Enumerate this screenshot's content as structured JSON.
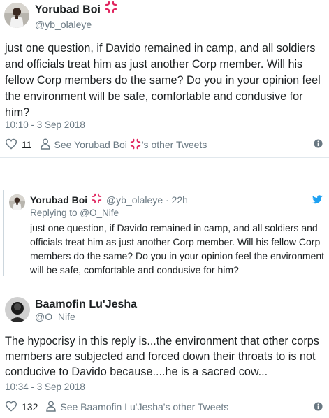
{
  "tweet1": {
    "name": "Yorubad Boi",
    "handle": "@yb_olaleye",
    "text": "just one question, if Davido remained in camp,  and all soldiers and officials treat him as just another Corp member.  Will his fellow Corp members do the same?  Do you in your opinion feel the environment will be safe, comfortable and condusive for him?",
    "timestamp": "10:10 - 3 Sep 2018",
    "likes": "11",
    "see_other_prefix": "See Yorubad Boi",
    "see_other_suffix": "'s other Tweets"
  },
  "tweet2": {
    "name": "Yorubad Boi",
    "handle": "@yb_olaleye",
    "separator": "·",
    "age": "22h",
    "replying_to": "Replying to @O_Nife",
    "text": "just one question, if Davido remained in camp,  and all soldiers and officials treat him as just another Corp member.  Will his fellow Corp members do the same?  Do you in your opinion feel the environment will be safe, comfortable and condusive for him?"
  },
  "tweet3": {
    "name": "Baamofin Lu'Jesha",
    "handle": "@O_Nife",
    "text": "The hypocrisy in this reply is...the environment that other corps members are subjected and forced down their throats to is not conducive to Davido because....he is a sacred cow...",
    "timestamp": "10:34 - 3 Sep 2018",
    "likes": "132",
    "see_other": "See Baamofin Lu'Jesha's other Tweets"
  },
  "colors": {
    "text": "#1c2022",
    "secondary": "#697882",
    "twitter_blue": "#1da1f2",
    "divider": "#e1e8ed",
    "anger_emoji": "#e0245e"
  },
  "icons": [
    "anger-symbol-icon",
    "heart-icon",
    "person-icon",
    "info-icon",
    "twitter-bird-icon"
  ]
}
